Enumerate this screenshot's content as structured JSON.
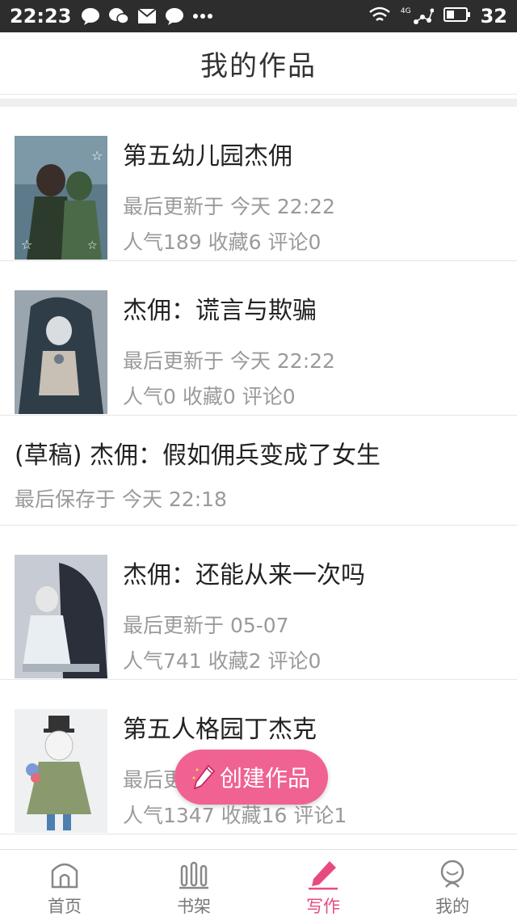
{
  "status_bar": {
    "time": "22:23",
    "network": "4G",
    "battery": "32"
  },
  "header": {
    "title": "我的作品"
  },
  "works": [
    {
      "type": "published",
      "title": "第五幼儿园杰佣",
      "updated": "最后更新于 今天 22:22",
      "stats": "人气189 收藏6 评论0"
    },
    {
      "type": "published",
      "title": "杰佣：谎言与欺骗",
      "updated": "最后更新于 今天 22:22",
      "stats": "人气0 收藏0 评论0"
    },
    {
      "type": "draft",
      "title": "(草稿) 杰佣：假如佣兵变成了女生",
      "updated": "最后保存于 今天 22:18"
    },
    {
      "type": "published",
      "title": "杰佣：还能从来一次吗",
      "updated": "最后更新于 05-07",
      "stats": "人气741 收藏2 评论0"
    },
    {
      "type": "published",
      "title": "第五人格园丁杰克",
      "updated": "最后更",
      "stats": "人气1347 收藏16 评论1"
    }
  ],
  "fab": {
    "label": "创建作品"
  },
  "tabbar": {
    "items": [
      {
        "label": "首页",
        "icon": "home-icon"
      },
      {
        "label": "书架",
        "icon": "bookshelf-icon"
      },
      {
        "label": "写作",
        "icon": "pencil-icon",
        "active": true
      },
      {
        "label": "我的",
        "icon": "profile-icon"
      }
    ]
  },
  "colors": {
    "accent": "#e84a7f",
    "fab": "#f06292",
    "statusbar": "#2d2d2d"
  }
}
